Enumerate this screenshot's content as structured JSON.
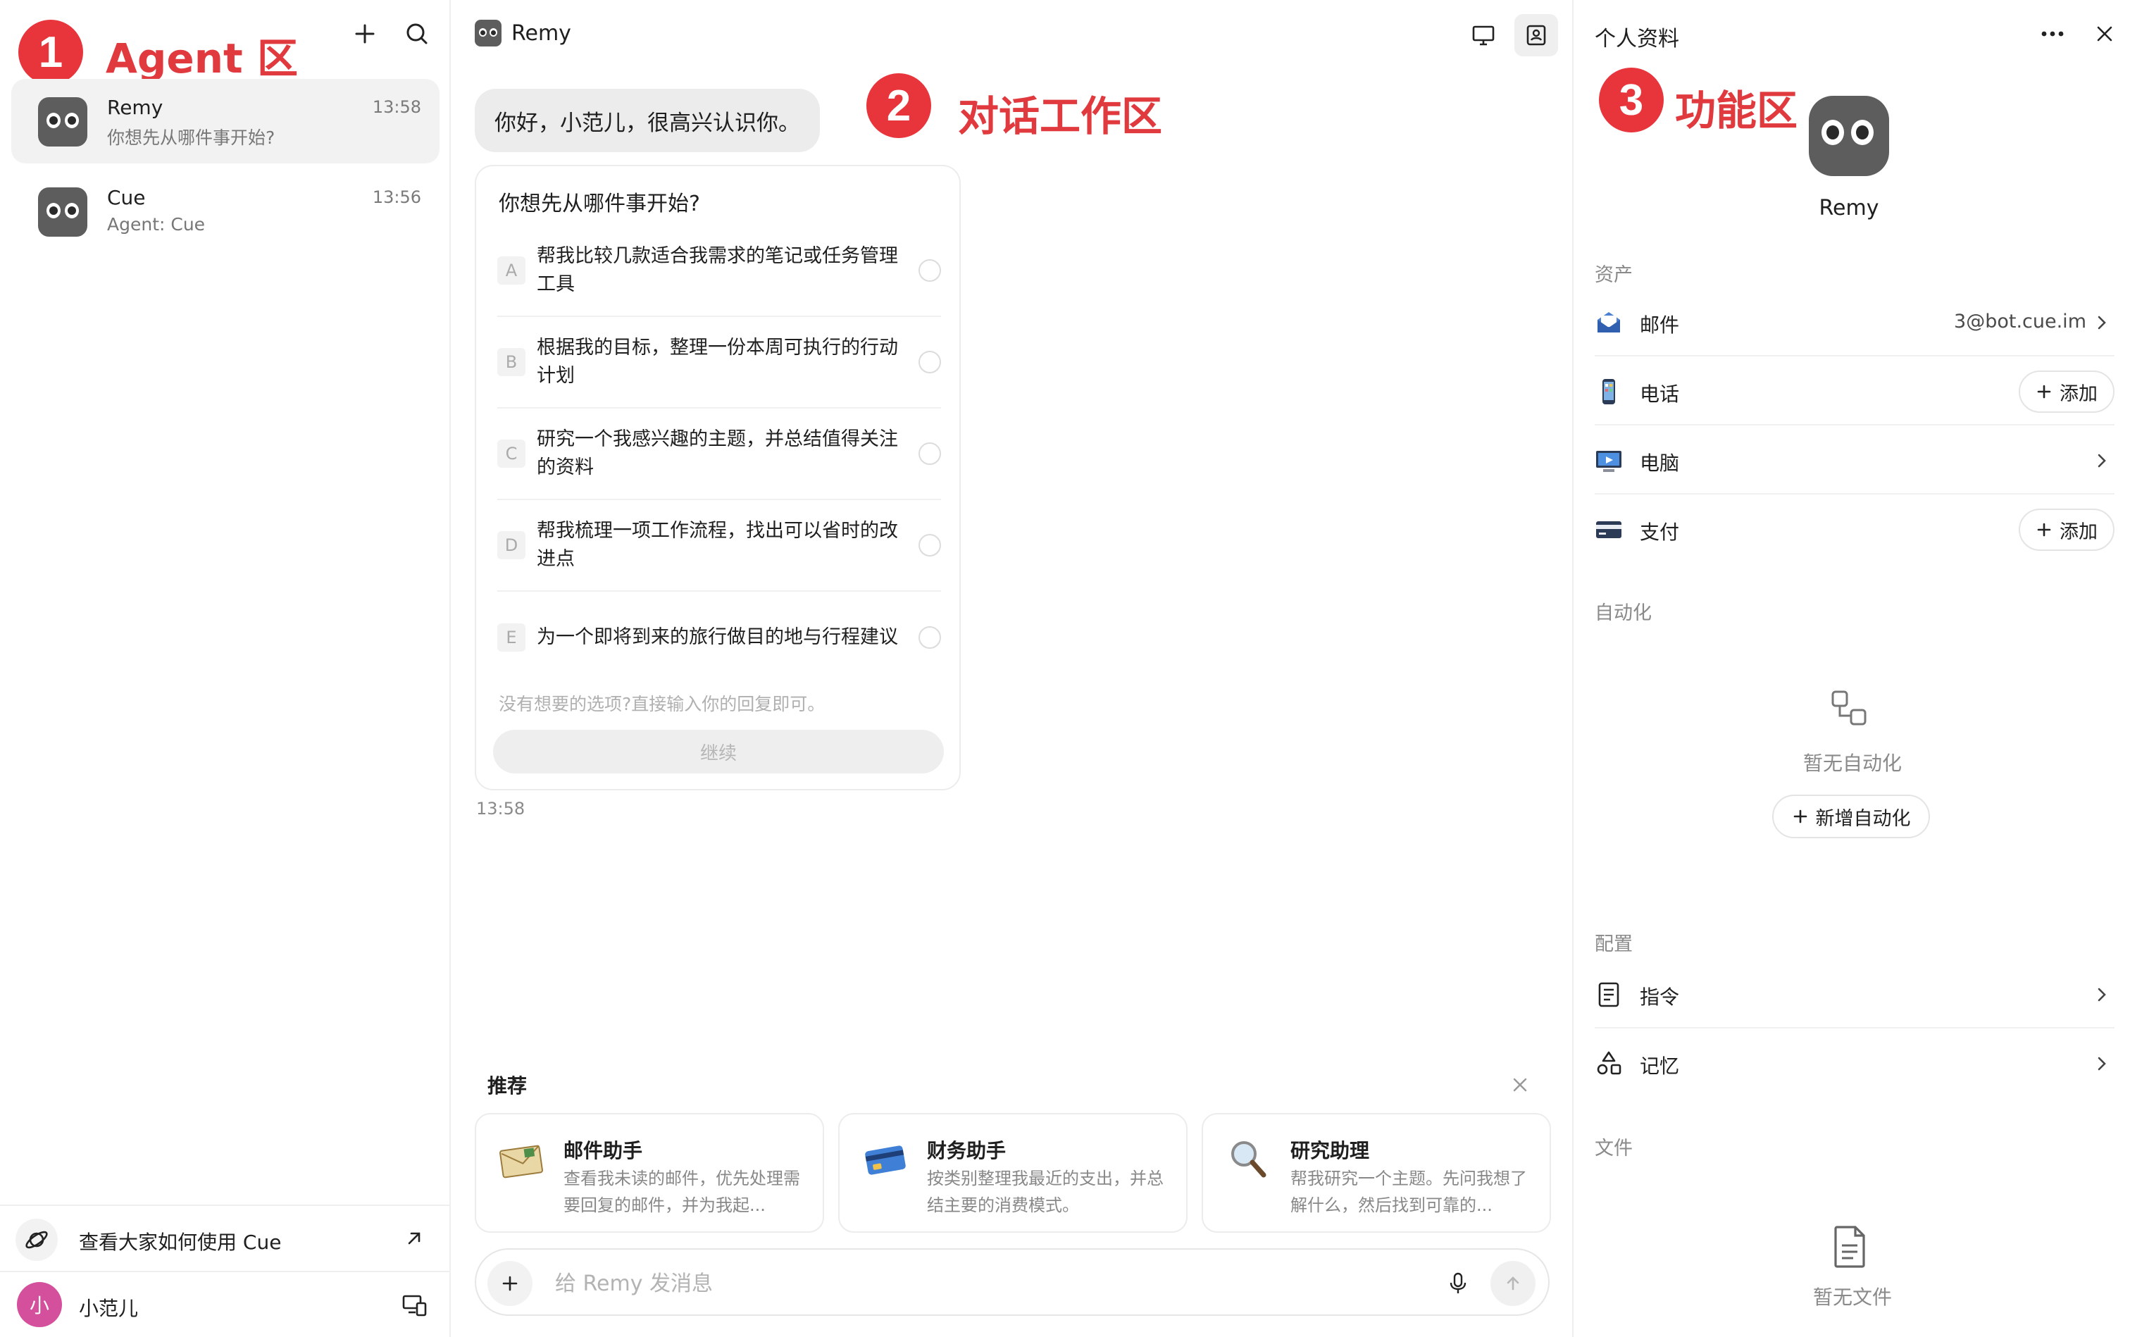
{
  "annotations": {
    "one": {
      "number": "1",
      "label": "Agent 区"
    },
    "two": {
      "number": "2",
      "label": "对话工作区"
    },
    "three": {
      "number": "3",
      "label": "功能区"
    }
  },
  "sidebar": {
    "new_chat_icon": "plus-icon",
    "search_icon": "search-icon",
    "chats": [
      {
        "name": "Remy",
        "time": "13:58",
        "preview": "你想先从哪件事开始?"
      },
      {
        "name": "Cue",
        "time": "13:56",
        "preview": "Agent: Cue"
      }
    ],
    "footer_link": "查看大家如何使用 Cue",
    "user": {
      "avatar_char": "小",
      "name": "小范儿"
    }
  },
  "chat": {
    "title": "Remy",
    "greeting": "你好，小范儿，很高兴认识你。",
    "question": {
      "title": "你想先从哪件事开始?",
      "options": [
        {
          "letter": "A",
          "text": "帮我比较几款适合我需求的笔记或任务管理工具"
        },
        {
          "letter": "B",
          "text": "根据我的目标，整理一份本周可执行的行动计划"
        },
        {
          "letter": "C",
          "text": "研究一个我感兴趣的主题，并总结值得关注的资料"
        },
        {
          "letter": "D",
          "text": "帮我梳理一项工作流程，找出可以省时的改进点"
        },
        {
          "letter": "E",
          "text": "为一个即将到来的旅行做目的地与行程建议"
        }
      ],
      "hint": "没有想要的选项?直接输入你的回复即可。",
      "continue_label": "继续"
    },
    "message_time": "13:58",
    "recommend": {
      "title": "推荐",
      "cards": [
        {
          "name": "邮件助手",
          "desc": "查看我未读的邮件，优先处理需要回复的邮件，并为我起...",
          "icon": "envelope-icon"
        },
        {
          "name": "财务助手",
          "desc": "按类别整理我最近的支出，并总结主要的消费模式。",
          "icon": "credit-card-icon"
        },
        {
          "name": "研究助理",
          "desc": "帮我研究一个主题。先问我想了解什么，然后找到可靠的...",
          "icon": "magnifier-icon"
        }
      ]
    },
    "composer": {
      "placeholder": "给 Remy 发消息"
    }
  },
  "profile": {
    "title": "个人资料",
    "name": "Remy",
    "assets_label": "资产",
    "assets": [
      {
        "label": "邮件",
        "value": "3@bot.cue.im",
        "type": "link"
      },
      {
        "label": "电话",
        "action": "添加",
        "type": "add"
      },
      {
        "label": "电脑",
        "type": "link"
      },
      {
        "label": "支付",
        "action": "添加",
        "type": "add"
      }
    ],
    "automation_label": "自动化",
    "automation_empty": "暂无自动化",
    "automation_add": "新增自动化",
    "config_label": "配置",
    "config": [
      {
        "label": "指令"
      },
      {
        "label": "记忆"
      }
    ],
    "files_label": "文件",
    "files_empty": "暂无文件"
  },
  "colors": {
    "accent_red": "#e8353b",
    "avatar_gray": "#5d5d5d",
    "user_avatar": "#d44f9c"
  }
}
